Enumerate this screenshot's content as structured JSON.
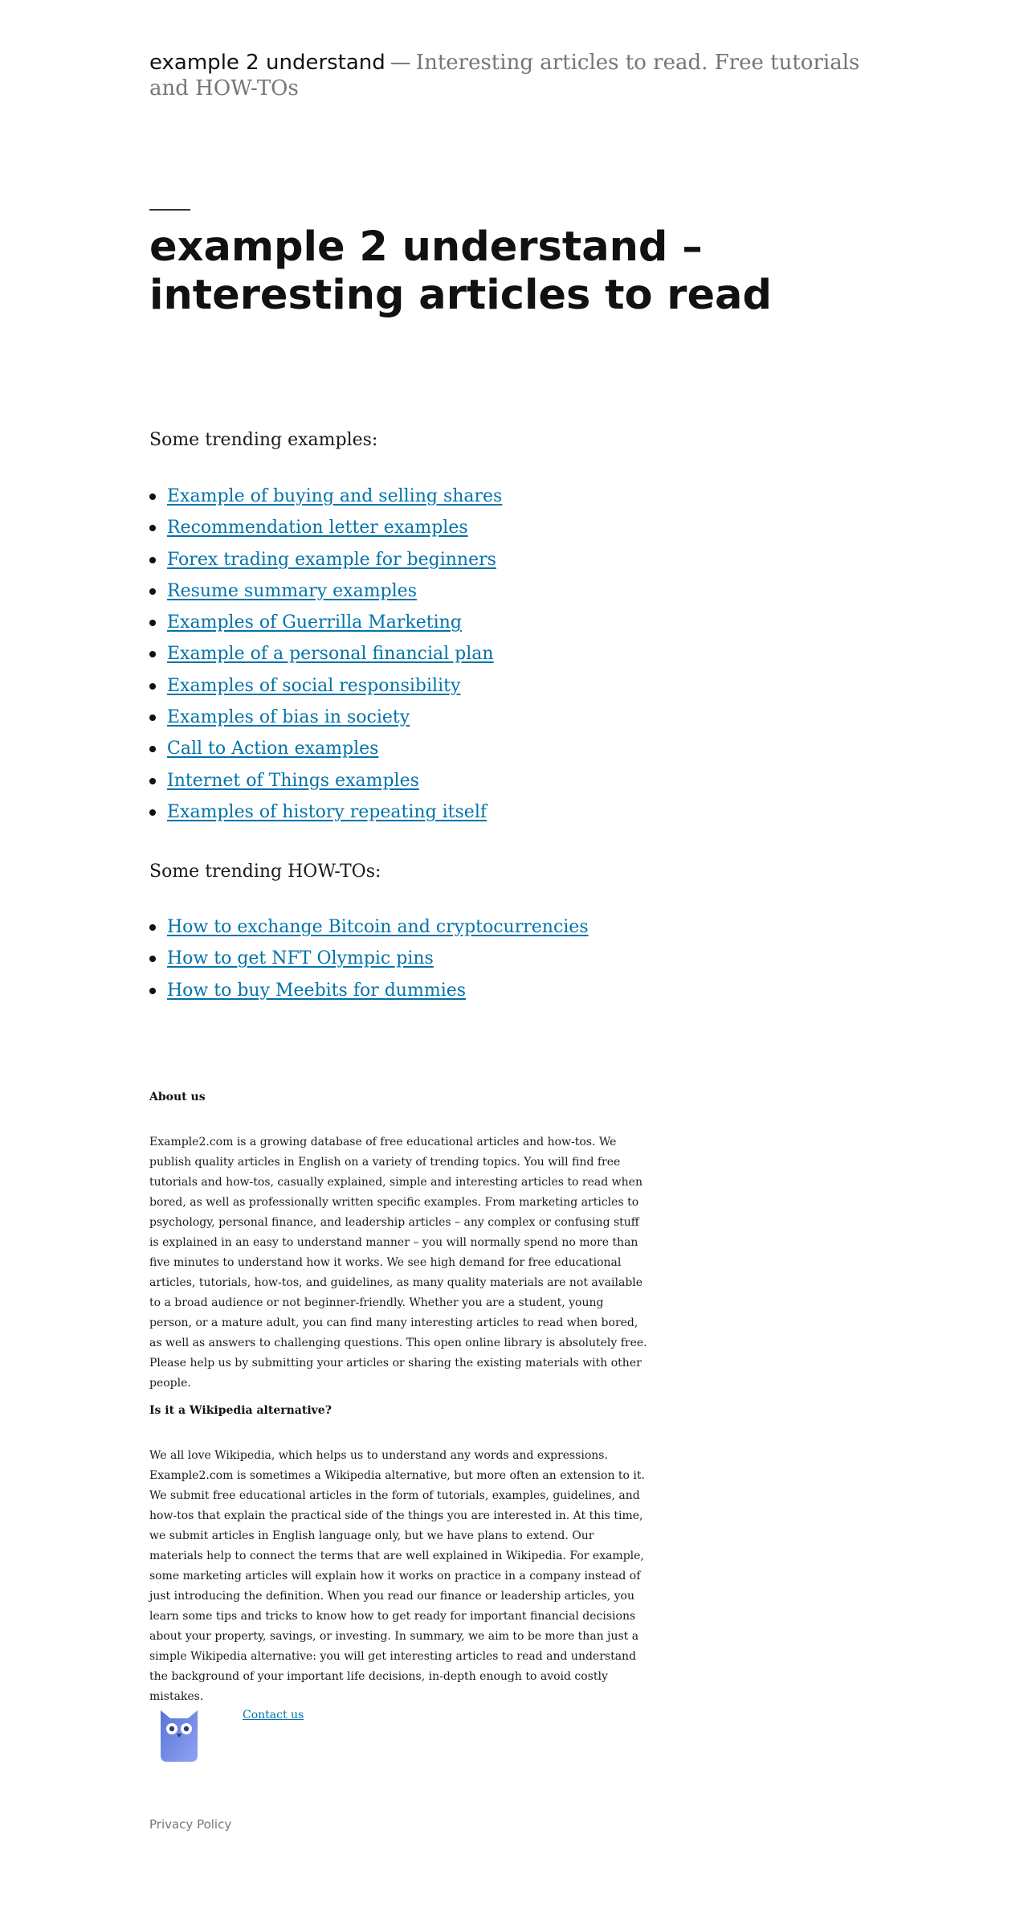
{
  "header": {
    "site_title": "example 2 understand",
    "separator": "—",
    "description": "Interesting articles to read. Free tutorials and HOW-TOs"
  },
  "page_title": "example 2 understand – interesting articles to read",
  "trending_examples": {
    "heading": "Some trending examples:",
    "items": [
      "Example of buying and selling shares",
      "Recommendation letter examples",
      "Forex trading example for beginners",
      "Resume summary examples",
      "Examples of Guerrilla Marketing",
      "Example of a personal financial plan",
      "Examples of social responsibility",
      "Examples of bias in society",
      "Call to Action examples",
      "Internet of Things examples",
      "Examples of history repeating itself"
    ]
  },
  "trending_howtos": {
    "heading": "Some trending HOW-TOs:",
    "items": [
      "How to exchange Bitcoin and cryptocurrencies",
      "How to get NFT Olympic pins",
      "How to buy Meebits for dummies"
    ]
  },
  "about": {
    "heading": "About us",
    "text": "Example2.com is a growing database of free educational articles and how-tos. We publish quality articles in English on a variety of trending topics. You will find free tutorials and how-tos, casually explained, simple and interesting articles to read when bored, as well as professionally written specific examples. From marketing articles to psychology, personal finance, and leadership articles – any complex or confusing stuff is explained in an easy to understand manner – you will normally spend no more than five minutes to understand how it works. We see high demand for free educational articles, tutorials, how-tos, and guidelines, as many quality materials are not available to a broad audience or not beginner-friendly. Whether you are a student, young person, or a mature adult, you can find many interesting articles to read when bored, as well as answers to challenging questions. This open online library is absolutely free. Please help us by submitting your articles or sharing the existing materials with other people."
  },
  "wikipedia": {
    "heading": "Is it a Wikipedia alternative?",
    "text": "We all love Wikipedia, which helps us to understand any words and expressions. Example2.com is sometimes a Wikipedia alternative, but more often an extension to it. We submit free educational articles in the form of tutorials, examples, guidelines, and how-tos that explain the practical side of the things you are interested in. At this time, we submit articles in English language only, but we have plans to extend. Our materials help to connect the terms that are well explained in Wikipedia. For example, some marketing articles will explain how it works on practice in a company instead of just introducing the definition. When you read our finance or leadership articles, you learn some tips and tricks to know how to get ready for important financial decisions about your property, savings, or investing. In summary, we aim to be more than just a simple Wikipedia alternative: you will get interesting articles to read and understand the background of your important life decisions, in-depth enough to avoid costly mistakes."
  },
  "contact_label": "Contact us",
  "footer": {
    "privacy_label": "Privacy Policy"
  },
  "colors": {
    "link": "#0073aa",
    "muted": "#767676",
    "logo": "#6b86e8"
  },
  "logo_icon": "owl-logo-icon"
}
